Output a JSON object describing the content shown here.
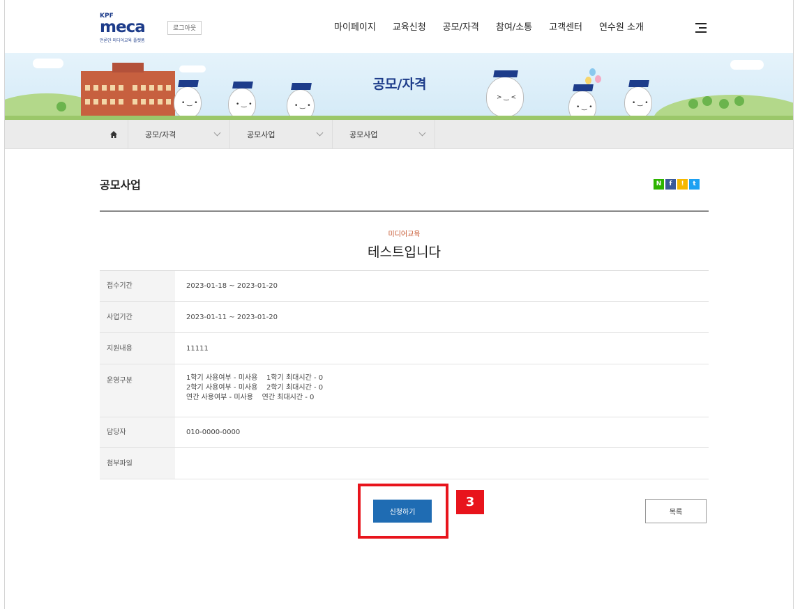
{
  "header": {
    "logo_kpf": "KPF",
    "logo_word": "meca",
    "logo_sub": "언론인·미디어교육 플랫폼",
    "logout_label": "로그아웃",
    "nav": [
      "마이페이지",
      "교육신청",
      "공모/자격",
      "참여/소통",
      "고객센터",
      "연수원 소개"
    ],
    "menu_icon": "hamburger-menu-icon"
  },
  "banner": {
    "title": "공모/자격"
  },
  "breadcrumb": {
    "home_icon": "home-icon",
    "items": [
      "공모/자격",
      "공모사업",
      "공모사업"
    ]
  },
  "page": {
    "heading": "공모사업",
    "share": [
      "N",
      "f",
      "!",
      "t"
    ]
  },
  "post": {
    "category": "미디어교육",
    "title": "테스트입니다",
    "rows": [
      {
        "label": "접수기간",
        "lines": [
          "2023-01-18 ~ 2023-01-20"
        ]
      },
      {
        "label": "사업기간",
        "lines": [
          "2023-01-11 ~ 2023-01-20"
        ]
      },
      {
        "label": "지원내용",
        "lines": [
          "11111"
        ]
      },
      {
        "label": "운영구분",
        "lines": [
          "1학기 사용여부 - 미사용    1학기 최대시간 - 0",
          "2학기 사용여부 - 미사용    2학기 최대시간 - 0",
          "연간 사용여부 - 미사용    연간 최대시간 - 0"
        ]
      },
      {
        "label": "담당자",
        "lines": [
          "010-0000-0000"
        ]
      },
      {
        "label": "첨부파일",
        "lines": [
          ""
        ]
      }
    ]
  },
  "actions": {
    "apply_label": "신청하기",
    "list_label": "목록"
  },
  "annotation": {
    "step_number": "3",
    "highlight_color": "#e8141c"
  },
  "colors": {
    "brand": "#1d3c8a",
    "primary_button": "#1f6cb3",
    "category": "#c6552d"
  }
}
